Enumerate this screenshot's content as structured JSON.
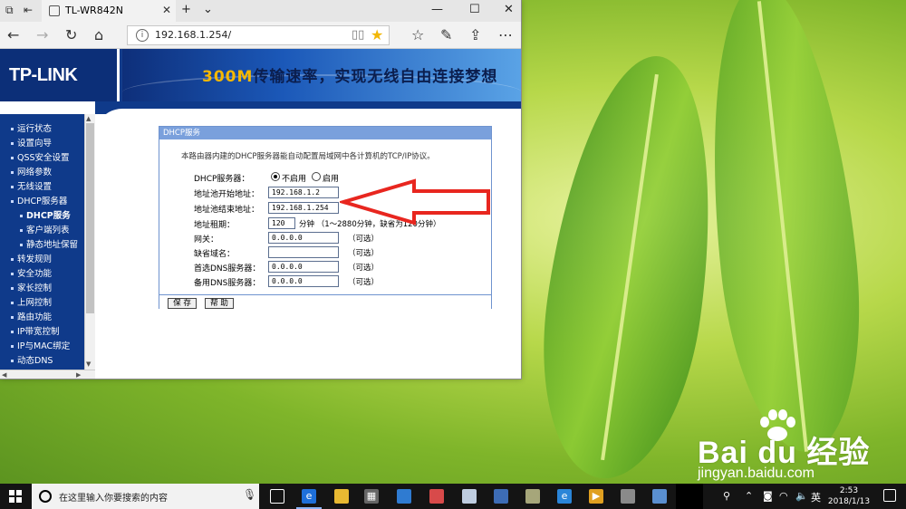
{
  "browser": {
    "tab_title": "TL-WR842N",
    "url": "192.168.1.254/",
    "window_controls": {
      "minimize": "—",
      "maximize": "☐",
      "close": "✕"
    },
    "new_tab": "+",
    "tab_menu": "⌄"
  },
  "router_page": {
    "logo": "TP-LINK",
    "slogan_highlight": "300M",
    "slogan_rest": "传输速率，实现无线自由连接梦想",
    "sidebar": [
      {
        "label": "运行状态",
        "sub": false
      },
      {
        "label": "设置向导",
        "sub": false
      },
      {
        "label": "QSS安全设置",
        "sub": false
      },
      {
        "label": "网络参数",
        "sub": false
      },
      {
        "label": "无线设置",
        "sub": false
      },
      {
        "label": "DHCP服务器",
        "sub": false,
        "expanded": true
      },
      {
        "label": "DHCP服务",
        "sub": true,
        "active": true
      },
      {
        "label": "客户端列表",
        "sub": true
      },
      {
        "label": "静态地址保留",
        "sub": true
      },
      {
        "label": "转发规则",
        "sub": false
      },
      {
        "label": "安全功能",
        "sub": false
      },
      {
        "label": "家长控制",
        "sub": false
      },
      {
        "label": "上网控制",
        "sub": false
      },
      {
        "label": "路由功能",
        "sub": false
      },
      {
        "label": "IP带宽控制",
        "sub": false
      },
      {
        "label": "IP与MAC绑定",
        "sub": false
      },
      {
        "label": "动态DNS",
        "sub": false
      }
    ],
    "dhcp": {
      "title": "DHCP服务",
      "description": "本路由器内建的DHCP服务器能自动配置局域网中各计算机的TCP/IP协议。",
      "server_label": "DHCP服务器：",
      "option_disable": "不启用",
      "option_enable": "启用",
      "selected": "disable",
      "start_label": "地址池开始地址：",
      "start_value": "192.168.1.2",
      "end_label": "地址池结束地址：",
      "end_value": "192.168.1.254",
      "lease_label": "地址租期：",
      "lease_value": "120",
      "lease_hint": "分钟 （1～2880分钟，缺省为120分钟）",
      "gateway_label": "网关：",
      "gateway_value": "0.0.0.0",
      "domain_label": "缺省域名：",
      "domain_value": "",
      "dns1_label": "首选DNS服务器：",
      "dns1_value": "0.0.0.0",
      "dns2_label": "备用DNS服务器：",
      "dns2_value": "0.0.0.0",
      "optional": "（可选）",
      "save_button": "保 存",
      "help_button": "帮 助"
    }
  },
  "watermark": {
    "brand": "Bai du 经验",
    "url": "jingyan.baidu.com"
  },
  "taskbar": {
    "search_placeholder": "在这里输入你要搜索的内容",
    "ime": "英",
    "time": "2:53",
    "date": "2018/1/13"
  },
  "colors": {
    "tplink_blue": "#0f3a8a",
    "panel_border": "#6f93cf",
    "arrow_red": "#e8261f",
    "slogan_yellow": "#f6b800"
  }
}
